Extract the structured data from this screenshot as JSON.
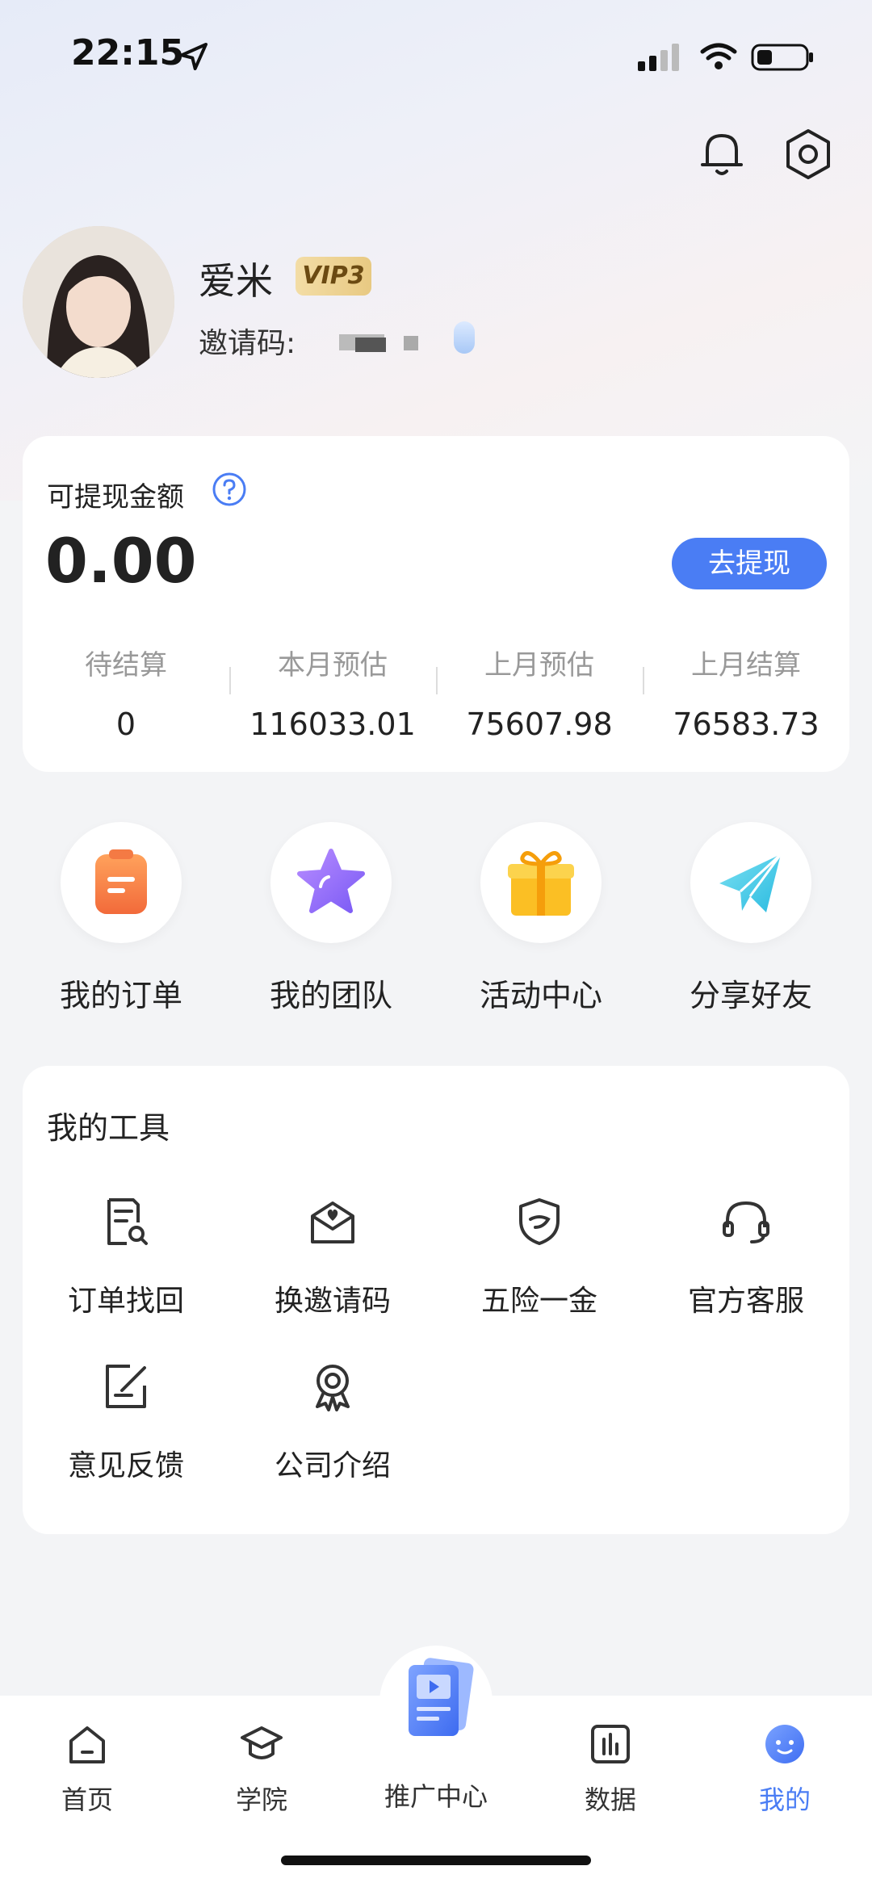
{
  "status_bar": {
    "time": "22:15"
  },
  "profile": {
    "name": "爱米",
    "vip": "VIP3",
    "invite_label": "邀请码:"
  },
  "withdraw": {
    "title": "可提现金额",
    "amount": "0.00",
    "button": "去提现",
    "stats": [
      {
        "label": "待结算",
        "value": "0"
      },
      {
        "label": "本月预估",
        "value": "116033.01"
      },
      {
        "label": "上月预估",
        "value": "75607.98"
      },
      {
        "label": "上月结算",
        "value": "76583.73"
      }
    ]
  },
  "quick_actions": [
    {
      "label": "我的订单",
      "icon": "order-icon"
    },
    {
      "label": "我的团队",
      "icon": "star-icon"
    },
    {
      "label": "活动中心",
      "icon": "gift-icon"
    },
    {
      "label": "分享好友",
      "icon": "paper-plane-icon"
    }
  ],
  "tools": {
    "title": "我的工具",
    "items": [
      {
        "label": "订单找回",
        "icon": "order-search-icon"
      },
      {
        "label": "换邀请码",
        "icon": "envelope-heart-icon"
      },
      {
        "label": "五险一金",
        "icon": "shield-icon"
      },
      {
        "label": "官方客服",
        "icon": "headset-icon"
      },
      {
        "label": "意见反馈",
        "icon": "edit-note-icon"
      },
      {
        "label": "公司介绍",
        "icon": "award-icon"
      }
    ]
  },
  "bottom_nav": [
    {
      "label": "首页",
      "icon": "home-icon"
    },
    {
      "label": "学院",
      "icon": "graduation-cap-icon"
    },
    {
      "label": "推广中心",
      "icon": "promo-video-icon"
    },
    {
      "label": "数据",
      "icon": "bar-chart-icon"
    },
    {
      "label": "我的",
      "icon": "smile-face-icon",
      "active": true
    }
  ],
  "colors": {
    "accent": "#4a7df4",
    "vip_gold": "#e8c982"
  }
}
